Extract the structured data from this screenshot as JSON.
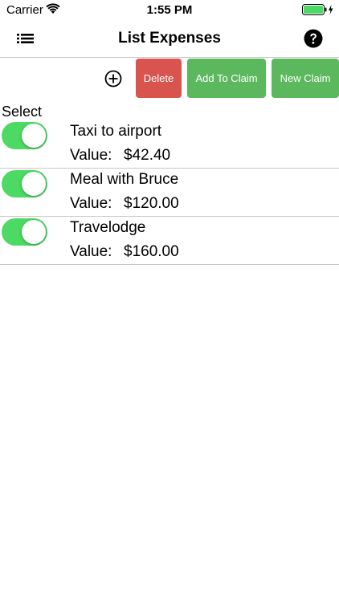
{
  "status_bar": {
    "carrier": "Carrier",
    "time": "1:55 PM",
    "wifi_icon": "wifi-icon",
    "battery_icon": "battery-charging-icon"
  },
  "nav": {
    "title": "List Expenses",
    "menu_icon": "list-icon",
    "help_icon": "help-circle-icon"
  },
  "toolbar": {
    "add_icon": "plus-circle-icon",
    "delete_label": "Delete",
    "add_to_claim_label": "Add To Claim",
    "new_claim_label": "New Claim"
  },
  "list": {
    "select_label": "Select",
    "items": [
      {
        "name": "Taxi to airport",
        "value_label": "Value:",
        "amount": "$42.40",
        "selected": true
      },
      {
        "name": "Meal with Bruce",
        "value_label": "Value:",
        "amount": "$120.00",
        "selected": true
      },
      {
        "name": "Travelodge",
        "value_label": "Value:",
        "amount": "$160.00",
        "selected": true
      }
    ]
  },
  "colors": {
    "accent_green": "#5cb85c",
    "toggle_green": "#4cd964",
    "delete_red": "#d9534f",
    "battery_green": "#4cd964"
  }
}
